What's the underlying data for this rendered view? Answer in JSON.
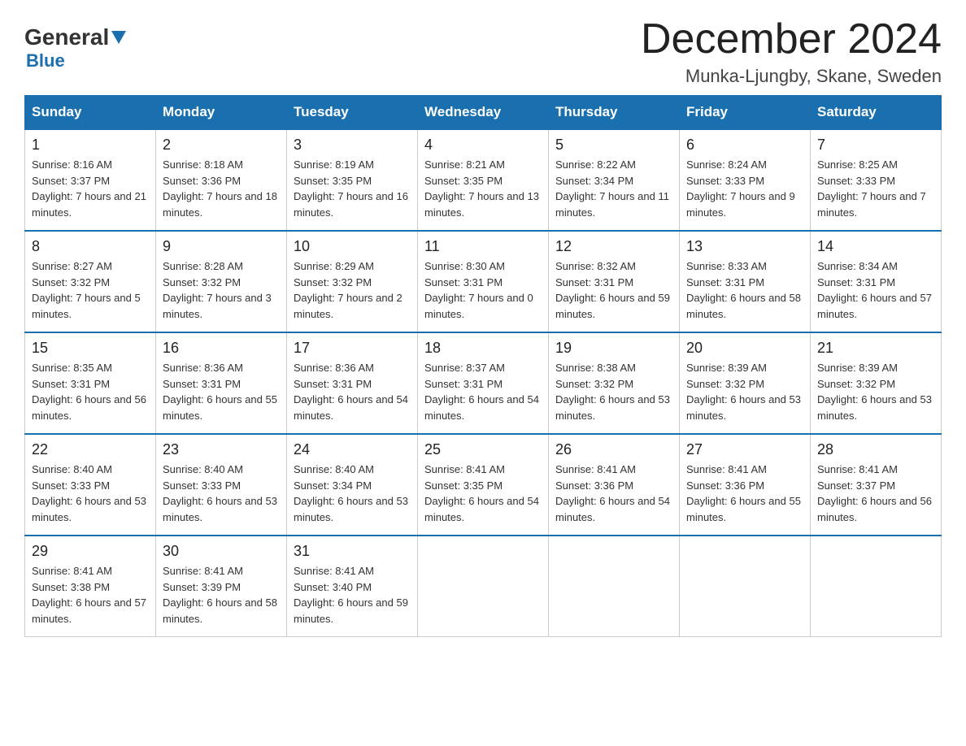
{
  "logo": {
    "general": "General",
    "blue": "Blue"
  },
  "title": "December 2024",
  "location": "Munka-Ljungby, Skane, Sweden",
  "days_header": [
    "Sunday",
    "Monday",
    "Tuesday",
    "Wednesday",
    "Thursday",
    "Friday",
    "Saturday"
  ],
  "weeks": [
    [
      {
        "day": "1",
        "sunrise": "8:16 AM",
        "sunset": "3:37 PM",
        "daylight": "7 hours and 21 minutes."
      },
      {
        "day": "2",
        "sunrise": "8:18 AM",
        "sunset": "3:36 PM",
        "daylight": "7 hours and 18 minutes."
      },
      {
        "day": "3",
        "sunrise": "8:19 AM",
        "sunset": "3:35 PM",
        "daylight": "7 hours and 16 minutes."
      },
      {
        "day": "4",
        "sunrise": "8:21 AM",
        "sunset": "3:35 PM",
        "daylight": "7 hours and 13 minutes."
      },
      {
        "day": "5",
        "sunrise": "8:22 AM",
        "sunset": "3:34 PM",
        "daylight": "7 hours and 11 minutes."
      },
      {
        "day": "6",
        "sunrise": "8:24 AM",
        "sunset": "3:33 PM",
        "daylight": "7 hours and 9 minutes."
      },
      {
        "day": "7",
        "sunrise": "8:25 AM",
        "sunset": "3:33 PM",
        "daylight": "7 hours and 7 minutes."
      }
    ],
    [
      {
        "day": "8",
        "sunrise": "8:27 AM",
        "sunset": "3:32 PM",
        "daylight": "7 hours and 5 minutes."
      },
      {
        "day": "9",
        "sunrise": "8:28 AM",
        "sunset": "3:32 PM",
        "daylight": "7 hours and 3 minutes."
      },
      {
        "day": "10",
        "sunrise": "8:29 AM",
        "sunset": "3:32 PM",
        "daylight": "7 hours and 2 minutes."
      },
      {
        "day": "11",
        "sunrise": "8:30 AM",
        "sunset": "3:31 PM",
        "daylight": "7 hours and 0 minutes."
      },
      {
        "day": "12",
        "sunrise": "8:32 AM",
        "sunset": "3:31 PM",
        "daylight": "6 hours and 59 minutes."
      },
      {
        "day": "13",
        "sunrise": "8:33 AM",
        "sunset": "3:31 PM",
        "daylight": "6 hours and 58 minutes."
      },
      {
        "day": "14",
        "sunrise": "8:34 AM",
        "sunset": "3:31 PM",
        "daylight": "6 hours and 57 minutes."
      }
    ],
    [
      {
        "day": "15",
        "sunrise": "8:35 AM",
        "sunset": "3:31 PM",
        "daylight": "6 hours and 56 minutes."
      },
      {
        "day": "16",
        "sunrise": "8:36 AM",
        "sunset": "3:31 PM",
        "daylight": "6 hours and 55 minutes."
      },
      {
        "day": "17",
        "sunrise": "8:36 AM",
        "sunset": "3:31 PM",
        "daylight": "6 hours and 54 minutes."
      },
      {
        "day": "18",
        "sunrise": "8:37 AM",
        "sunset": "3:31 PM",
        "daylight": "6 hours and 54 minutes."
      },
      {
        "day": "19",
        "sunrise": "8:38 AM",
        "sunset": "3:32 PM",
        "daylight": "6 hours and 53 minutes."
      },
      {
        "day": "20",
        "sunrise": "8:39 AM",
        "sunset": "3:32 PM",
        "daylight": "6 hours and 53 minutes."
      },
      {
        "day": "21",
        "sunrise": "8:39 AM",
        "sunset": "3:32 PM",
        "daylight": "6 hours and 53 minutes."
      }
    ],
    [
      {
        "day": "22",
        "sunrise": "8:40 AM",
        "sunset": "3:33 PM",
        "daylight": "6 hours and 53 minutes."
      },
      {
        "day": "23",
        "sunrise": "8:40 AM",
        "sunset": "3:33 PM",
        "daylight": "6 hours and 53 minutes."
      },
      {
        "day": "24",
        "sunrise": "8:40 AM",
        "sunset": "3:34 PM",
        "daylight": "6 hours and 53 minutes."
      },
      {
        "day": "25",
        "sunrise": "8:41 AM",
        "sunset": "3:35 PM",
        "daylight": "6 hours and 54 minutes."
      },
      {
        "day": "26",
        "sunrise": "8:41 AM",
        "sunset": "3:36 PM",
        "daylight": "6 hours and 54 minutes."
      },
      {
        "day": "27",
        "sunrise": "8:41 AM",
        "sunset": "3:36 PM",
        "daylight": "6 hours and 55 minutes."
      },
      {
        "day": "28",
        "sunrise": "8:41 AM",
        "sunset": "3:37 PM",
        "daylight": "6 hours and 56 minutes."
      }
    ],
    [
      {
        "day": "29",
        "sunrise": "8:41 AM",
        "sunset": "3:38 PM",
        "daylight": "6 hours and 57 minutes."
      },
      {
        "day": "30",
        "sunrise": "8:41 AM",
        "sunset": "3:39 PM",
        "daylight": "6 hours and 58 minutes."
      },
      {
        "day": "31",
        "sunrise": "8:41 AM",
        "sunset": "3:40 PM",
        "daylight": "6 hours and 59 minutes."
      },
      null,
      null,
      null,
      null
    ]
  ],
  "labels": {
    "sunrise": "Sunrise:",
    "sunset": "Sunset:",
    "daylight": "Daylight:"
  }
}
